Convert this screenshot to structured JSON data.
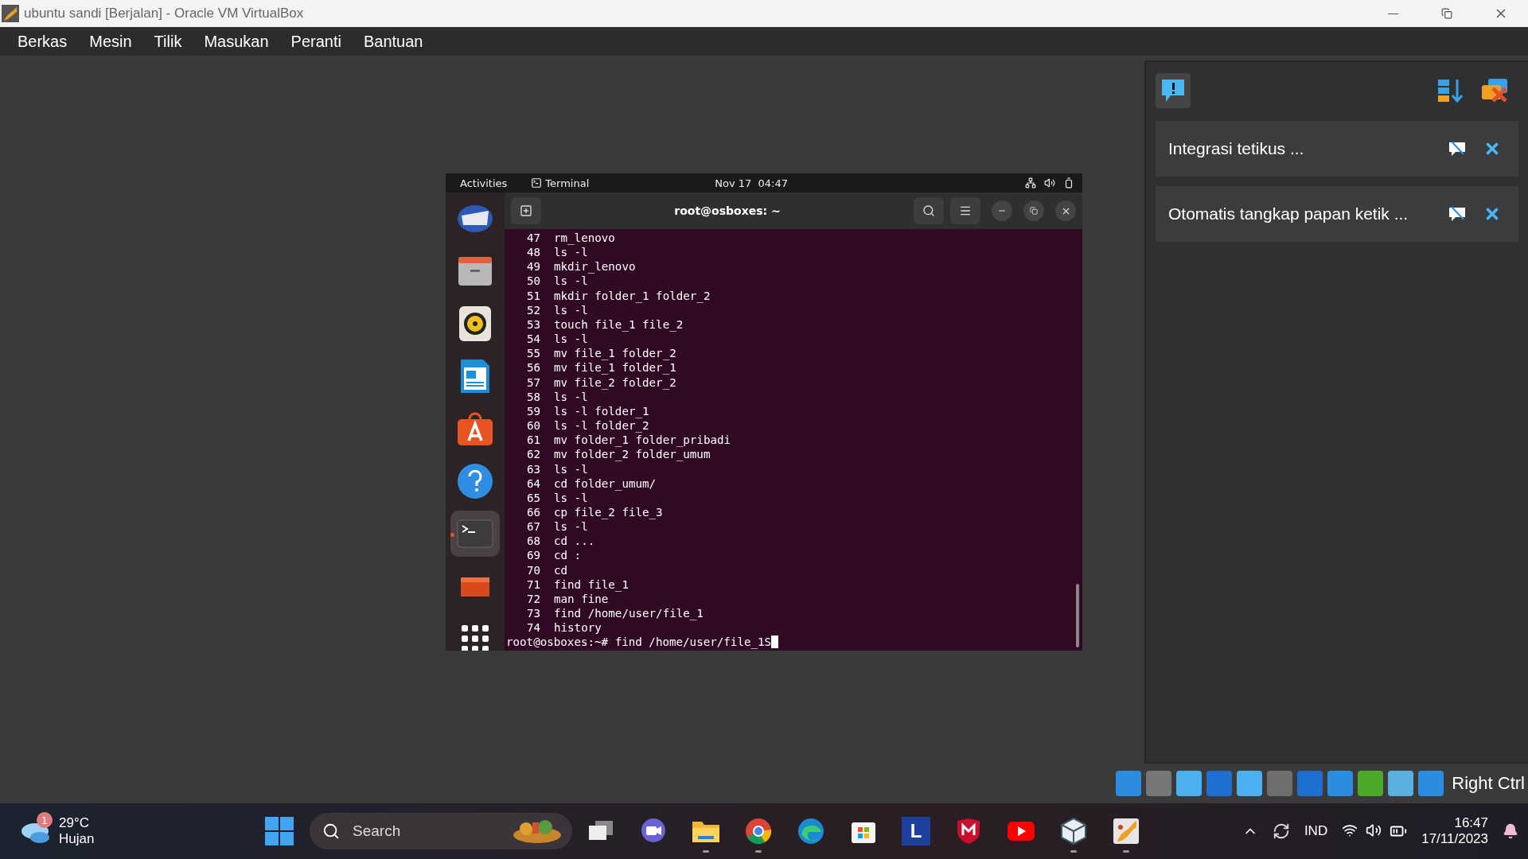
{
  "window": {
    "title": "ubuntu sandi [Berjalan] - Oracle VM VirtualBox"
  },
  "menu": [
    "Berkas",
    "Mesin",
    "Tilik",
    "Masukan",
    "Peranti",
    "Bantuan"
  ],
  "guest": {
    "top_bar": {
      "activities": "Activities",
      "app": "Terminal",
      "clock": "Nov 17  04:47"
    },
    "dock": [
      {
        "kind": "mail",
        "selected": false
      },
      {
        "kind": "files",
        "selected": false
      },
      {
        "kind": "music",
        "selected": false
      },
      {
        "kind": "writer",
        "selected": false
      },
      {
        "kind": "store",
        "selected": false
      },
      {
        "kind": "help",
        "selected": false
      },
      {
        "kind": "terminal",
        "selected": true
      },
      {
        "kind": "screenshot",
        "selected": false
      },
      {
        "kind": "apps",
        "selected": false
      }
    ],
    "terminal": {
      "title": "root@osboxes: ~",
      "lines": [
        {
          "number": "47",
          "command": "rm_lenovo"
        },
        {
          "number": "48",
          "command": "ls -l"
        },
        {
          "number": "49",
          "command": "mkdir_lenovo"
        },
        {
          "number": "50",
          "command": "ls -l"
        },
        {
          "number": "51",
          "command": "mkdir folder_1 folder_2"
        },
        {
          "number": "52",
          "command": "ls -l"
        },
        {
          "number": "53",
          "command": "touch file_1 file_2"
        },
        {
          "number": "54",
          "command": "ls -l"
        },
        {
          "number": "55",
          "command": "mv file_1 folder_2"
        },
        {
          "number": "56",
          "command": "mv file_1 folder_1"
        },
        {
          "number": "57",
          "command": "mv file_2 folder_2"
        },
        {
          "number": "58",
          "command": "ls -l"
        },
        {
          "number": "59",
          "command": "ls -l folder_1"
        },
        {
          "number": "60",
          "command": "ls -l folder_2"
        },
        {
          "number": "61",
          "command": "mv folder_1 folder_pribadi"
        },
        {
          "number": "62",
          "command": "mv folder_2 folder_umum"
        },
        {
          "number": "63",
          "command": "ls -l"
        },
        {
          "number": "64",
          "command": "cd folder_umum/"
        },
        {
          "number": "65",
          "command": "ls -l"
        },
        {
          "number": "66",
          "command": "cp file_2 file_3"
        },
        {
          "number": "67",
          "command": "ls -l"
        },
        {
          "number": "68",
          "command": "cd ..."
        },
        {
          "number": "69",
          "command": "cd :"
        },
        {
          "number": "70",
          "command": "cd"
        },
        {
          "number": "71",
          "command": "find file_1"
        },
        {
          "number": "72",
          "command": "man fine"
        },
        {
          "number": "73",
          "command": "find /home/user/file_1"
        },
        {
          "number": "74",
          "command": "history"
        }
      ],
      "prompt": "root@osboxes:~#",
      "input": "find /home/user/file_1S"
    }
  },
  "notifications": [
    {
      "text": "Integrasi tetikus ..."
    },
    {
      "text": "Otomatis tangkap papan ketik ..."
    }
  ],
  "status_bar": {
    "host_key": "Right Ctrl"
  },
  "taskbar": {
    "weather": {
      "badge": "1",
      "temperature": "29°C",
      "condition": "Hujan"
    },
    "search": {
      "placeholder": "Search"
    },
    "apps": [
      {
        "kind": "taskview",
        "running": false
      },
      {
        "kind": "meet",
        "running": false
      },
      {
        "kind": "explorer",
        "running": true
      },
      {
        "kind": "chrome",
        "running": true
      },
      {
        "kind": "edge",
        "running": false
      },
      {
        "kind": "store",
        "running": false
      },
      {
        "kind": "letter",
        "label": "L",
        "running": false
      },
      {
        "kind": "shield",
        "running": false
      },
      {
        "kind": "youtube",
        "running": false
      },
      {
        "kind": "cube",
        "running": true
      },
      {
        "kind": "vbox",
        "running": true
      }
    ],
    "tray": {
      "language": "IND",
      "time": "16:47",
      "date": "17/11/2023"
    }
  }
}
